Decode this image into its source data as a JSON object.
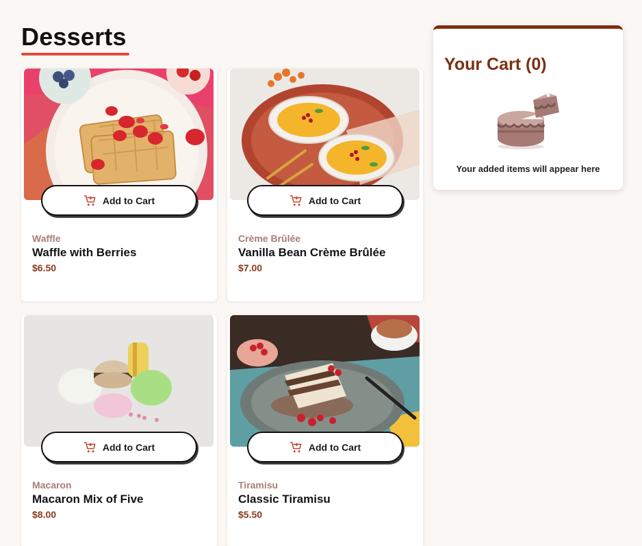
{
  "page": {
    "title": "Desserts"
  },
  "products": [
    {
      "category": "Waffle",
      "name": "Waffle with Berries",
      "price": "$6.50",
      "button_label": "Add to Cart"
    },
    {
      "category": "Crème Brûlée",
      "name": "Vanilla Bean Crème Brûlée",
      "price": "$7.00",
      "button_label": "Add to Cart"
    },
    {
      "category": "Macaron",
      "name": "Macaron Mix of Five",
      "price": "$8.00",
      "button_label": "Add to Cart"
    },
    {
      "category": "Tiramisu",
      "name": "Classic Tiramisu",
      "price": "$5.50",
      "button_label": "Add to Cart"
    }
  ],
  "cart": {
    "title": "Your Cart (0)",
    "empty_message": "Your added items will appear here",
    "illustration": "empty-cake-icon"
  },
  "colors": {
    "accent_red": "#e04b3b",
    "brand_brown": "#7a3114",
    "category_text": "#a87c78",
    "price_text": "#8a3a1c",
    "background": "#fbf7f4"
  },
  "icons": {
    "button_icon": "add-to-cart-icon"
  }
}
